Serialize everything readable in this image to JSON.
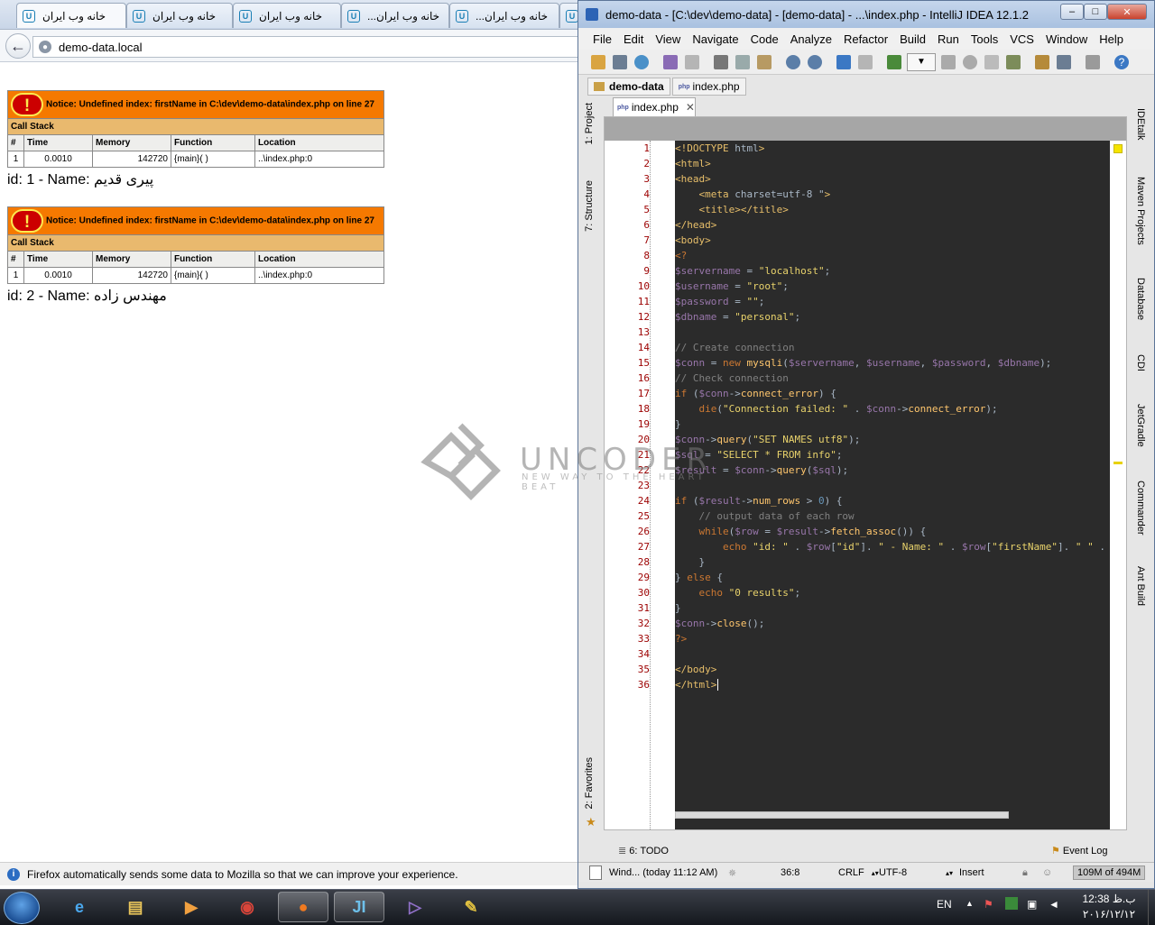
{
  "browser": {
    "tabs": [
      {
        "label": "خانه وب ایران",
        "icon": "u-icon"
      },
      {
        "label": "خانه وب ایران",
        "icon": "u-icon"
      },
      {
        "label": "خانه وب ایران",
        "icon": "u-icon"
      },
      {
        "label": "...خانه وب ایران",
        "icon": "u-icon"
      },
      {
        "label": "...خانه وب ایران",
        "icon": "u-icon"
      }
    ],
    "url": "demo-data.local",
    "errors": [
      {
        "bang": "( ! )",
        "notice": "Notice: Undefined index: firstName in C:\\dev\\demo-data\\index.php on line 27",
        "callstack_label": "Call Stack",
        "headers": [
          "#",
          "Time",
          "Memory",
          "Function",
          "Location"
        ],
        "row": [
          "1",
          "0.0010",
          "142720",
          "{main}( )",
          "..\\index.php:0"
        ],
        "output": "id: 1 - Name: پیری قدیم"
      },
      {
        "bang": "( ! )",
        "notice": "Notice: Undefined index: firstName in C:\\dev\\demo-data\\index.php on line 27",
        "callstack_label": "Call Stack",
        "headers": [
          "#",
          "Time",
          "Memory",
          "Function",
          "Location"
        ],
        "row": [
          "1",
          "0.0010",
          "142720",
          "{main}( )",
          "..\\index.php:0"
        ],
        "output": "id: 2 - Name: مهندس زاده"
      }
    ],
    "notification": "Firefox automatically sends some data to Mozilla so that we can improve your experience."
  },
  "ide": {
    "title": "demo-data - [C:\\dev\\demo-data] - [demo-data] - ...\\index.php - IntelliJ IDEA 12.1.2",
    "menu": [
      "File",
      "Edit",
      "View",
      "Navigate",
      "Code",
      "Analyze",
      "Refactor",
      "Build",
      "Run",
      "Tools",
      "VCS",
      "Window",
      "Help"
    ],
    "breadcrumb": [
      "demo-data",
      "index.php"
    ],
    "editor_tab": "index.php",
    "left_tools": [
      "1: Project",
      "7: Structure",
      "2: Favorites"
    ],
    "right_tools": [
      "IDEtalk",
      "Maven Projects",
      "Database",
      "CDI",
      "JetGradle",
      "Commander",
      "Ant Build"
    ],
    "line_numbers": [
      "1",
      "2",
      "3",
      "4",
      "5",
      "6",
      "7",
      "8",
      "9",
      "10",
      "11",
      "12",
      "13",
      "14",
      "15",
      "16",
      "17",
      "18",
      "19",
      "20",
      "21",
      "22",
      "23",
      "24",
      "25",
      "26",
      "27",
      "28",
      "29",
      "30",
      "31",
      "32",
      "33",
      "34",
      "35",
      "36"
    ],
    "code_lines": [
      "<!DOCTYPE html>",
      "<html>",
      "<head>",
      "    <meta charset=\"utf-8 \">",
      "    <title></title>",
      "</head>",
      "<body>",
      "<?",
      "$servername = \"localhost\";",
      "$username = \"root\";",
      "$password = \"\";",
      "$dbname = \"personal\";",
      "",
      "// Create connection",
      "$conn = new mysqli($servername, $username, $password, $dbname);",
      "// Check connection",
      "if ($conn->connect_error) {",
      "    die(\"Connection failed: \" . $conn->connect_error);",
      "}",
      "$conn->query(\"SET NAMES utf8\");",
      "$sql = \"SELECT * FROM info\";",
      "$result = $conn->query($sql);",
      "",
      "if ($result->num_rows > 0) {",
      "    // output data of each row",
      "    while($row = $result->fetch_assoc()) {",
      "        echo \"id: \" . $row[\"id\"]. \" - Name: \" . $row[\"firstName\"]. \" \" .",
      "    }",
      "} else {",
      "    echo \"0 results\";",
      "}",
      "$conn->close();",
      "?>",
      "",
      "</body>",
      "</html>"
    ],
    "bottom_tools": {
      "todo": "6: TODO",
      "event_log": "Event Log"
    },
    "status": {
      "message": "Wind... (today 11:12 AM)",
      "position": "36:8",
      "line_sep": "CRLF",
      "encoding": "UTF-8",
      "mode": "Insert",
      "memory": "109M of 494M"
    }
  },
  "watermark": {
    "brand": "UNCODER",
    "tagline": "NEW WAY TO THE HEART BEAT"
  },
  "taskbar": {
    "lang": "EN",
    "time": "12:38 ب.ظ",
    "date": "۲۰۱۶/۱۲/۱۲"
  }
}
